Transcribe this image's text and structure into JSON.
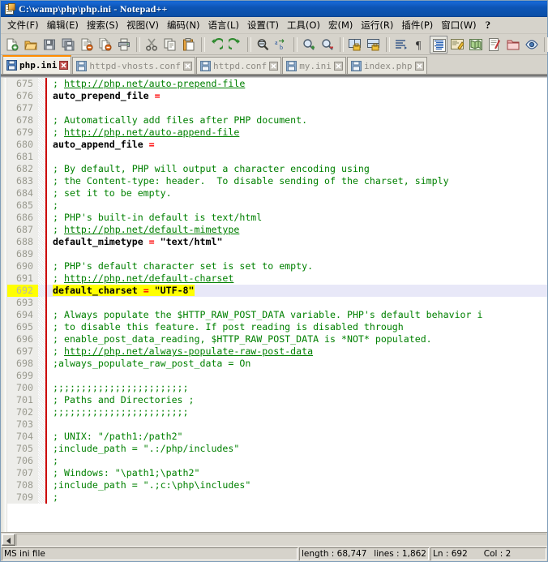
{
  "window": {
    "title": "C:\\wamp\\php\\php.ini - Notepad++",
    "icon": "notepad-plus-plus-icon"
  },
  "menubar": {
    "items": [
      {
        "label": "文件(F)",
        "name": "menu-file"
      },
      {
        "label": "编辑(E)",
        "name": "menu-edit"
      },
      {
        "label": "搜索(S)",
        "name": "menu-search"
      },
      {
        "label": "视图(V)",
        "name": "menu-view"
      },
      {
        "label": "编码(N)",
        "name": "menu-encoding"
      },
      {
        "label": "语言(L)",
        "name": "menu-language"
      },
      {
        "label": "设置(T)",
        "name": "menu-settings"
      },
      {
        "label": "工具(O)",
        "name": "menu-tools"
      },
      {
        "label": "宏(M)",
        "name": "menu-macro"
      },
      {
        "label": "运行(R)",
        "name": "menu-run"
      },
      {
        "label": "插件(P)",
        "name": "menu-plugins"
      },
      {
        "label": "窗口(W)",
        "name": "menu-window"
      },
      {
        "label": "?",
        "name": "menu-help"
      }
    ]
  },
  "toolbar": {
    "buttons": [
      {
        "name": "new-file-icon",
        "tip": "新建"
      },
      {
        "name": "open-file-icon",
        "tip": "打开"
      },
      {
        "name": "save-icon",
        "tip": "保存"
      },
      {
        "name": "save-all-icon",
        "tip": "保存所有"
      },
      {
        "name": "close-file-icon",
        "tip": "关闭"
      },
      {
        "name": "close-all-icon",
        "tip": "关闭所有"
      },
      {
        "name": "print-icon",
        "tip": "打印"
      },
      {
        "name": "separator-1",
        "tip": ""
      },
      {
        "name": "cut-icon",
        "tip": "剪切"
      },
      {
        "name": "copy-icon",
        "tip": "复制"
      },
      {
        "name": "paste-icon",
        "tip": "粘贴"
      },
      {
        "name": "separator-2",
        "tip": ""
      },
      {
        "name": "undo-icon",
        "tip": "撤销"
      },
      {
        "name": "redo-icon",
        "tip": "重做"
      },
      {
        "name": "separator-3",
        "tip": ""
      },
      {
        "name": "find-icon",
        "tip": "查找"
      },
      {
        "name": "replace-icon",
        "tip": "替换"
      },
      {
        "name": "separator-4",
        "tip": ""
      },
      {
        "name": "zoom-in-icon",
        "tip": "放大"
      },
      {
        "name": "zoom-out-icon",
        "tip": "缩小"
      },
      {
        "name": "separator-5",
        "tip": ""
      },
      {
        "name": "sync-vertical-icon",
        "tip": "垂直同步"
      },
      {
        "name": "sync-horizontal-icon",
        "tip": "水平同步"
      },
      {
        "name": "separator-6",
        "tip": ""
      },
      {
        "name": "word-wrap-icon",
        "tip": "自动换行"
      },
      {
        "name": "show-all-chars-icon",
        "tip": "显示所有字符"
      },
      {
        "name": "indent-guide-icon",
        "tip": "缩进参考线"
      },
      {
        "name": "user-language-icon",
        "tip": "用户自定义语言"
      },
      {
        "name": "doc-map-icon",
        "tip": "文档地图"
      },
      {
        "name": "function-list-icon",
        "tip": "函数列表"
      },
      {
        "name": "folder-workspace-icon",
        "tip": "文件夹作为工作区"
      },
      {
        "name": "monitoring-icon",
        "tip": "监视"
      },
      {
        "name": "separator-7",
        "tip": ""
      },
      {
        "name": "record-macro-icon",
        "tip": "录制宏"
      }
    ]
  },
  "tabs": [
    {
      "label": "php.ini",
      "active": true,
      "name": "tab-php-ini"
    },
    {
      "label": "httpd-vhosts.conf",
      "active": false,
      "name": "tab-httpd-vhosts-conf"
    },
    {
      "label": "httpd.conf",
      "active": false,
      "name": "tab-httpd-conf"
    },
    {
      "label": "my.ini",
      "active": false,
      "name": "tab-my-ini"
    },
    {
      "label": "index.php",
      "active": false,
      "name": "tab-index-php"
    }
  ],
  "editor": {
    "lines": [
      {
        "n": "675",
        "parts": [
          {
            "t": "; ",
            "c": "c-com"
          },
          {
            "t": "http://php.net/auto-prepend-file",
            "c": "c-url"
          }
        ]
      },
      {
        "n": "676",
        "parts": [
          {
            "t": "auto_prepend_file ",
            "c": "c-key"
          },
          {
            "t": "=",
            "c": "c-op"
          }
        ]
      },
      {
        "n": "677",
        "parts": []
      },
      {
        "n": "678",
        "parts": [
          {
            "t": "; Automatically add files after PHP document.",
            "c": "c-com"
          }
        ]
      },
      {
        "n": "679",
        "parts": [
          {
            "t": "; ",
            "c": "c-com"
          },
          {
            "t": "http://php.net/auto-append-file",
            "c": "c-url"
          }
        ]
      },
      {
        "n": "680",
        "parts": [
          {
            "t": "auto_append_file ",
            "c": "c-key"
          },
          {
            "t": "=",
            "c": "c-op"
          }
        ]
      },
      {
        "n": "681",
        "parts": []
      },
      {
        "n": "682",
        "parts": [
          {
            "t": "; By default, PHP will output a character encoding using",
            "c": "c-com"
          }
        ]
      },
      {
        "n": "683",
        "parts": [
          {
            "t": "; the Content-type: header.  To disable sending of the charset, simply",
            "c": "c-com"
          }
        ]
      },
      {
        "n": "684",
        "parts": [
          {
            "t": "; set it to be empty.",
            "c": "c-com"
          }
        ]
      },
      {
        "n": "685",
        "parts": [
          {
            "t": ";",
            "c": "c-com"
          }
        ]
      },
      {
        "n": "686",
        "parts": [
          {
            "t": "; PHP's built-in default is text/html",
            "c": "c-com"
          }
        ]
      },
      {
        "n": "687",
        "parts": [
          {
            "t": "; ",
            "c": "c-com"
          },
          {
            "t": "http://php.net/default-mimetype",
            "c": "c-url"
          }
        ]
      },
      {
        "n": "688",
        "parts": [
          {
            "t": "default_mimetype ",
            "c": "c-key"
          },
          {
            "t": "= ",
            "c": "c-op"
          },
          {
            "t": "\"text/html\"",
            "c": "c-str"
          }
        ]
      },
      {
        "n": "689",
        "parts": []
      },
      {
        "n": "690",
        "parts": [
          {
            "t": "; PHP's default character set is set to empty.",
            "c": "c-com"
          }
        ]
      },
      {
        "n": "691",
        "parts": [
          {
            "t": "; ",
            "c": "c-com"
          },
          {
            "t": "http://php.net/default-charset",
            "c": "c-url"
          }
        ]
      },
      {
        "n": "692",
        "current": true,
        "lnmark": true,
        "parts": [
          {
            "t": "default_charset ",
            "c": "c-key",
            "mark": true
          },
          {
            "t": "= ",
            "c": "c-op",
            "mark": true
          },
          {
            "t": "\"UTF-8\"",
            "c": "c-str",
            "mark": true
          }
        ]
      },
      {
        "n": "693",
        "parts": []
      },
      {
        "n": "694",
        "parts": [
          {
            "t": "; Always populate the $HTTP_RAW_POST_DATA variable. PHP's default behavior i",
            "c": "c-com"
          }
        ]
      },
      {
        "n": "695",
        "parts": [
          {
            "t": "; to disable this feature. If post reading is disabled through",
            "c": "c-com"
          }
        ]
      },
      {
        "n": "696",
        "parts": [
          {
            "t": "; enable_post_data_reading, $HTTP_RAW_POST_DATA is *NOT* populated.",
            "c": "c-com"
          }
        ]
      },
      {
        "n": "697",
        "parts": [
          {
            "t": "; ",
            "c": "c-com"
          },
          {
            "t": "http://php.net/always-populate-raw-post-data",
            "c": "c-url"
          }
        ]
      },
      {
        "n": "698",
        "parts": [
          {
            "t": ";always_populate_raw_post_data = On",
            "c": "c-com"
          }
        ]
      },
      {
        "n": "699",
        "parts": []
      },
      {
        "n": "700",
        "parts": [
          {
            "t": ";;;;;;;;;;;;;;;;;;;;;;;;",
            "c": "c-com"
          }
        ]
      },
      {
        "n": "701",
        "parts": [
          {
            "t": "; Paths and Directories ;",
            "c": "c-com"
          }
        ]
      },
      {
        "n": "702",
        "parts": [
          {
            "t": ";;;;;;;;;;;;;;;;;;;;;;;;",
            "c": "c-com"
          }
        ]
      },
      {
        "n": "703",
        "parts": []
      },
      {
        "n": "704",
        "parts": [
          {
            "t": "; UNIX: \"/path1:/path2\"",
            "c": "c-com"
          }
        ]
      },
      {
        "n": "705",
        "parts": [
          {
            "t": ";include_path = \".:/php/includes\"",
            "c": "c-com"
          }
        ]
      },
      {
        "n": "706",
        "parts": [
          {
            "t": ";",
            "c": "c-com"
          }
        ]
      },
      {
        "n": "707",
        "parts": [
          {
            "t": "; Windows: \"\\path1;\\path2\"",
            "c": "c-com"
          }
        ]
      },
      {
        "n": "708",
        "parts": [
          {
            "t": ";include_path = \".;c:\\php\\includes\"",
            "c": "c-com"
          }
        ]
      },
      {
        "n": "709",
        "parts": [
          {
            "t": ";",
            "c": "c-com"
          }
        ]
      }
    ]
  },
  "statusbar": {
    "filetype": "MS ini file",
    "length_label": "length : 68,747",
    "lines_label": "lines : 1,862",
    "ln_label": "Ln : 692",
    "col_label": "Col : 2"
  },
  "colors": {
    "titlebar_blue": "#0d55b6",
    "comment_green": "#008000",
    "operator_red": "#ff0000",
    "highlight_yellow": "#ffff00",
    "current_line": "#e8e8f8",
    "active_tab_accent": "#ff8c00",
    "chrome_gray": "#d6d3cb"
  }
}
